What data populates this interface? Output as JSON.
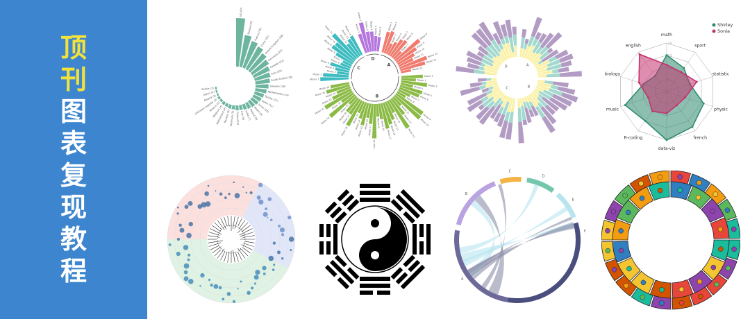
{
  "sidebar": {
    "chars": [
      "顶",
      "刊",
      "图",
      "表",
      "复",
      "现",
      "教",
      "程"
    ],
    "colors": {
      "background": "#3d86cf",
      "highlight": "#f3e23c",
      "text": "#ffffff"
    }
  },
  "panels": {
    "bar_circular": {
      "labels": [
        "US (60)",
        "Russia (40)",
        "France (35)",
        "China (32)",
        "United Kingdom (28)",
        "Germany (25)",
        "Canada (22)",
        "Italy (20)",
        "Saudi Arabia (18)",
        "Sweden (16)",
        "Netherlands (14)",
        "Turkey (12)",
        "Spain (11)",
        "Israel (10)",
        "Brazil (9)",
        "Poland (8)",
        "India (7)",
        "Iran (6)",
        "Finland (6)",
        "Denmark (5)",
        "Norway (5)",
        "Switzerland (4)",
        "Belgium (4)",
        "Mexico (3)",
        "Unknown supplier (3)",
        "Poland (2)",
        "Japan (2)",
        "Serbia (2)"
      ],
      "values": [
        60,
        40,
        35,
        32,
        28,
        25,
        22,
        20,
        18,
        16,
        14,
        12,
        11,
        10,
        9,
        8,
        7,
        6,
        6,
        5,
        5,
        4,
        4,
        3,
        3,
        2,
        2,
        2
      ],
      "color": "#6eb5a0"
    },
    "grouped_circular": {
      "groups": [
        "A",
        "B",
        "C",
        "D"
      ],
      "colors": [
        "#f07b6e",
        "#8bbb46",
        "#3cbcc0",
        "#b577de"
      ]
    },
    "stacked_circular": {
      "colors": [
        "#fbf1a6",
        "#a3d9cf",
        "#b39cc3"
      ],
      "groups": [
        "A",
        "B",
        "C",
        "D"
      ]
    },
    "radar": {
      "axes": [
        "math",
        "sport",
        "statistic",
        "physic",
        "french",
        "data-viz",
        "R-coding",
        "music",
        "biology",
        "english"
      ],
      "ticks": [
        "5",
        "10",
        "15",
        "20"
      ],
      "series": [
        {
          "name": "Shirley",
          "color": "#2e8b6e",
          "values": [
            15,
            12,
            10,
            16,
            18,
            20,
            15,
            18,
            10,
            8
          ]
        },
        {
          "name": "Sonia",
          "color": "#c4326e",
          "values": [
            11,
            10,
            13,
            8,
            7,
            9,
            10,
            8,
            12,
            19
          ]
        }
      ]
    },
    "dendro_circular": {
      "sector_colors": [
        "#f7c6c2",
        "#c8d4f3",
        "#c5e8cc"
      ]
    },
    "bagua": {
      "icon": "yin-yang-bagua-icon"
    },
    "chord": {
      "sectors": [
        "A",
        "B",
        "C",
        "D",
        "E",
        "F"
      ],
      "colors": [
        "#b8e4ee",
        "#4a4e7d",
        "#6d6a9a",
        "#b9a3e2",
        "#f4b343",
        "#74c6ad"
      ]
    },
    "zodiac": {
      "icon": "zodiac-mural-ring-icon"
    }
  }
}
